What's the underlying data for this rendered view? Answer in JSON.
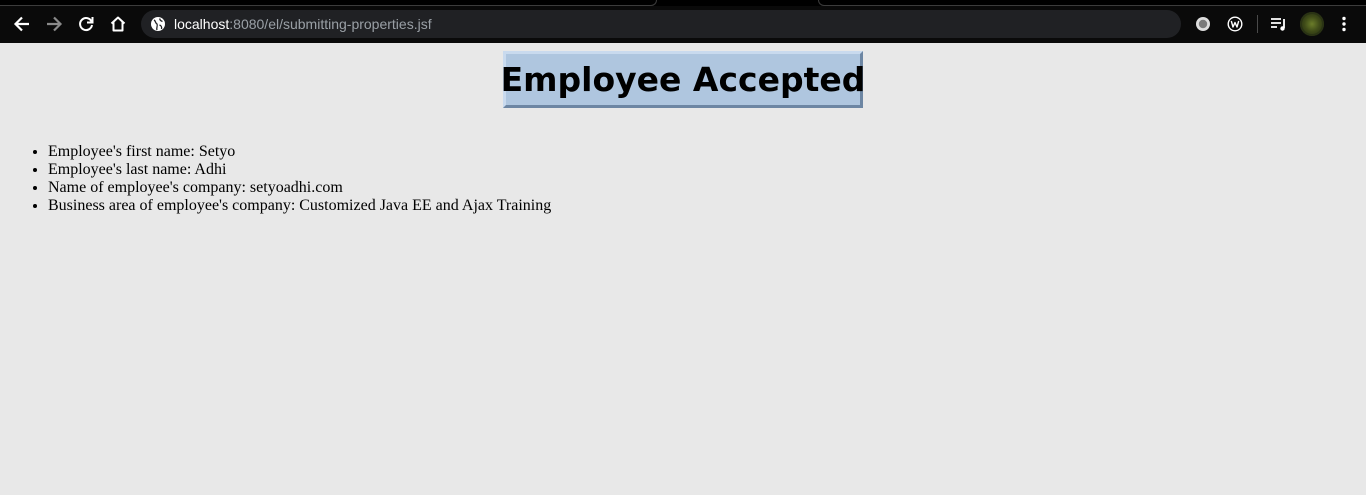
{
  "browser": {
    "url_host": "localhost",
    "url_rest": ":8080/el/submitting-properties.jsf",
    "icons": {
      "back": "arrow-left-icon",
      "forward": "arrow-right-icon",
      "reload": "reload-icon",
      "home": "home-icon",
      "site_info": "globe-icon",
      "extension_1": "record-icon",
      "extension_2": "w-circle-icon",
      "media": "playlist-icon",
      "menu": "kebab-menu-icon"
    }
  },
  "page": {
    "heading": "Employee Accepted",
    "heading_bg": "#afc6df",
    "page_bg": "#e8e8e8",
    "details": [
      "Employee's first name: Setyo",
      "Employee's last name: Adhi",
      "Name of employee's company: setyoadhi.com",
      "Business area of employee's company: Customized Java EE and Ajax Training"
    ]
  }
}
